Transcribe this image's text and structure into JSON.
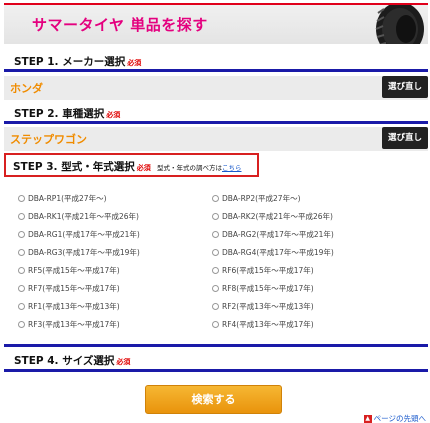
{
  "banner": {
    "title": "サマータイヤ 単品を探す"
  },
  "required_mark": "必須",
  "step1": {
    "label": "STEP 1. メーカー選択",
    "selected": "ホンダ",
    "redo_label": "選び直し"
  },
  "step2": {
    "label": "STEP 2. 車種選択",
    "selected": "ステップワゴン",
    "redo_label": "選び直し"
  },
  "step3": {
    "label": "STEP 3. 型式・年式選択",
    "hint_text": "型式・年式の調べ方は",
    "hint_link": "こちら",
    "options": [
      "DBA-RP1(平成27年〜)",
      "DBA-RP2(平成27年〜)",
      "DBA-RK1(平成21年〜平成26年)",
      "DBA-RK2(平成21年〜平成26年)",
      "DBA-RG1(平成17年〜平成21年)",
      "DBA-RG2(平成17年〜平成21年)",
      "DBA-RG3(平成17年〜平成19年)",
      "DBA-RG4(平成17年〜平成19年)",
      "RF5(平成15年〜平成17年)",
      "RF6(平成15年〜平成17年)",
      "RF7(平成15年〜平成17年)",
      "RF8(平成15年〜平成17年)",
      "RF1(平成13年〜平成13年)",
      "RF2(平成13年〜平成13年)",
      "RF3(平成13年〜平成17年)",
      "RF4(平成13年〜平成17年)"
    ]
  },
  "step4": {
    "label": "STEP 4. サイズ選択"
  },
  "search_button": "検索する",
  "page_top_link": "ページの先頭へ",
  "colors": {
    "accent_blue": "#1a1aa8",
    "banner_pink": "#e4007f",
    "selection_orange": "#f08c00",
    "button_orange": "#f0a020"
  },
  "icons": {
    "banner": "tire-image",
    "page_top": "arrow-up-icon"
  }
}
